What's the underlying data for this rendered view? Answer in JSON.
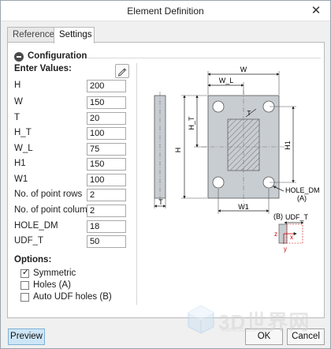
{
  "window": {
    "title": "Element Definition",
    "close_glyph": "✕"
  },
  "tabs": [
    {
      "label": "References",
      "active": false
    },
    {
      "label": "Settings",
      "active": true
    }
  ],
  "configuration": {
    "section_label": "Configuration",
    "enter_values_label": "Enter Values:",
    "edit_icon": "pencil-icon",
    "fields": [
      {
        "label": "H",
        "value": "200"
      },
      {
        "label": "W",
        "value": "150"
      },
      {
        "label": "T",
        "value": "20"
      },
      {
        "label": "H_T",
        "value": "100"
      },
      {
        "label": "W_L",
        "value": "75"
      },
      {
        "label": "H1",
        "value": "150"
      },
      {
        "label": "W1",
        "value": "100"
      },
      {
        "label": "No. of point rows",
        "value": "2"
      },
      {
        "label": "No. of point columns",
        "value": "2"
      },
      {
        "label": "HOLE_DM",
        "value": "18"
      },
      {
        "label": "UDF_T",
        "value": "50"
      }
    ]
  },
  "options": {
    "label": "Options:",
    "items": [
      {
        "label": "Symmetric",
        "checked": true
      },
      {
        "label": "Holes (A)",
        "checked": false
      },
      {
        "label": "Auto UDF holes (B)",
        "checked": false
      }
    ],
    "check_glyph": "✓"
  },
  "diagram": {
    "W": "W",
    "W_L": "W_L",
    "H": "H",
    "H_T": "H_T",
    "H1": "H1",
    "W1": "W1",
    "T": "T",
    "HOLE_DM": "HOLE_DM",
    "A": "(A)",
    "B": "(B)",
    "UDF_T": "UDF_T",
    "z": "z",
    "x": "x",
    "y": "y",
    "colors": {
      "plate": "#c8cdd2",
      "hatch": "#555555",
      "axis_x": "#cc0000",
      "axis_y": "#cc0000",
      "axis_z": "#cc0000"
    }
  },
  "buttons": {
    "preview": "Preview",
    "ok": "OK",
    "cancel": "Cancel"
  },
  "watermark": {
    "text": "3D世界网",
    "sub": "WWW.3DSJW.COM"
  }
}
